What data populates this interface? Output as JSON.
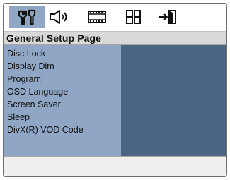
{
  "tabs": [
    {
      "name": "general-setup",
      "icon": "tools-icon",
      "active": true
    },
    {
      "name": "audio-setup",
      "icon": "speaker-icon",
      "active": false
    },
    {
      "name": "video-setup",
      "icon": "film-strip-icon",
      "active": false
    },
    {
      "name": "preference",
      "icon": "grid-icon",
      "active": false
    },
    {
      "name": "exit",
      "icon": "exit-door-icon",
      "active": false
    }
  ],
  "page": {
    "title": "General Setup Page"
  },
  "menu": {
    "items": [
      "Disc Lock",
      "Display Dim",
      "Program",
      "OSD Language",
      "Screen Saver",
      "Sleep",
      "DivX(R) VOD Code"
    ]
  },
  "colors": {
    "accent": "#8fa6c4",
    "value_panel": "#4c6584",
    "title_bar": "#d9d9d9"
  }
}
